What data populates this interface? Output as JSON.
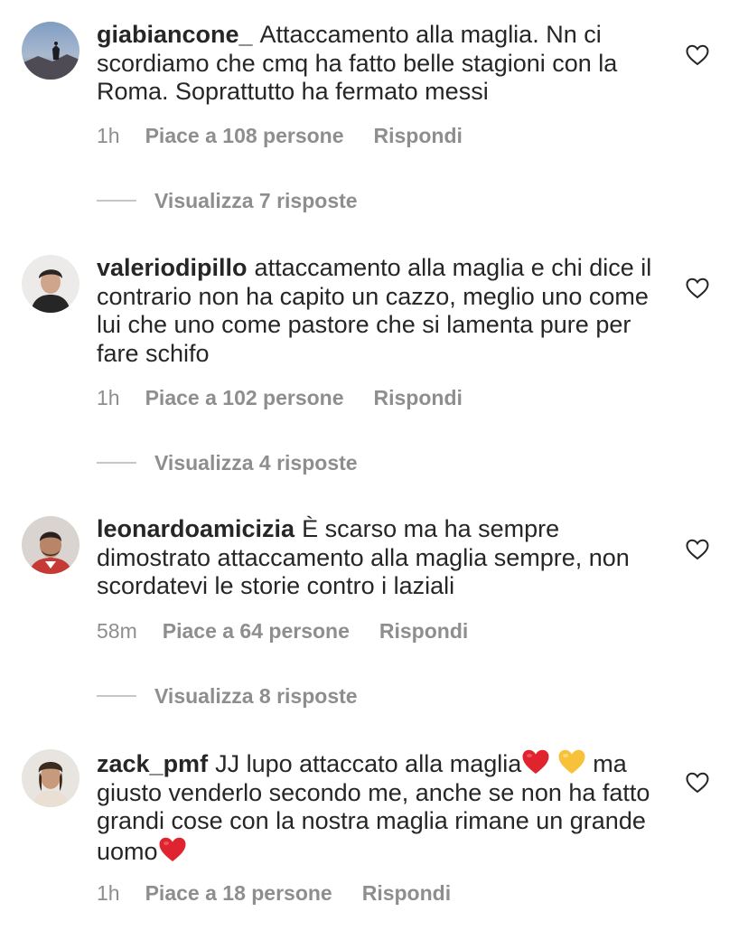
{
  "comments": [
    {
      "username": "giabiancone_",
      "text": "Attaccamento alla maglia. Nn ci scordiamo che cmq ha fatto belle stagioni con la Roma. Soprattutto ha fermato messi",
      "time": "1h",
      "likes": "Piace a 108 persone",
      "reply": "Rispondi",
      "view_replies": "Visualizza 7 risposte"
    },
    {
      "username": "valeriodipillo",
      "text": "attaccamento alla maglia e chi dice il contrario non ha capito un cazzo, meglio uno come lui che uno come pastore che si lamenta pure per fare schifo",
      "time": "1h",
      "likes": "Piace a 102 persone",
      "reply": "Rispondi",
      "view_replies": "Visualizza 4 risposte"
    },
    {
      "username": "leonardoamicizia",
      "text": "È scarso ma ha sempre dimostrato attaccamento alla maglia sempre, non scordatevi le storie contro i laziali",
      "time": "58m",
      "likes": "Piace a 64 persone",
      "reply": "Rispondi",
      "view_replies": "Visualizza 8 risposte"
    },
    {
      "username": "zack_pmf",
      "text_part1": "JJ lupo attaccato alla maglia",
      "text_part2": "ma giusto venderlo secondo me, anche se non ha fatto grandi cose con la nostra maglia rimane un grande uomo",
      "time": "1h",
      "likes": "Piace a 18 persone",
      "reply": "Rispondi"
    }
  ],
  "icons": {
    "like": "heart-outline-icon",
    "emoji_red_heart": "red-heart-emoji",
    "emoji_yellow_heart": "yellow-heart-emoji"
  },
  "colors": {
    "text": "#262626",
    "secondary": "#8e8e8e",
    "divider": "#c7c7c7",
    "red_heart": "#e0242f",
    "yellow_heart": "#f7c23a"
  }
}
